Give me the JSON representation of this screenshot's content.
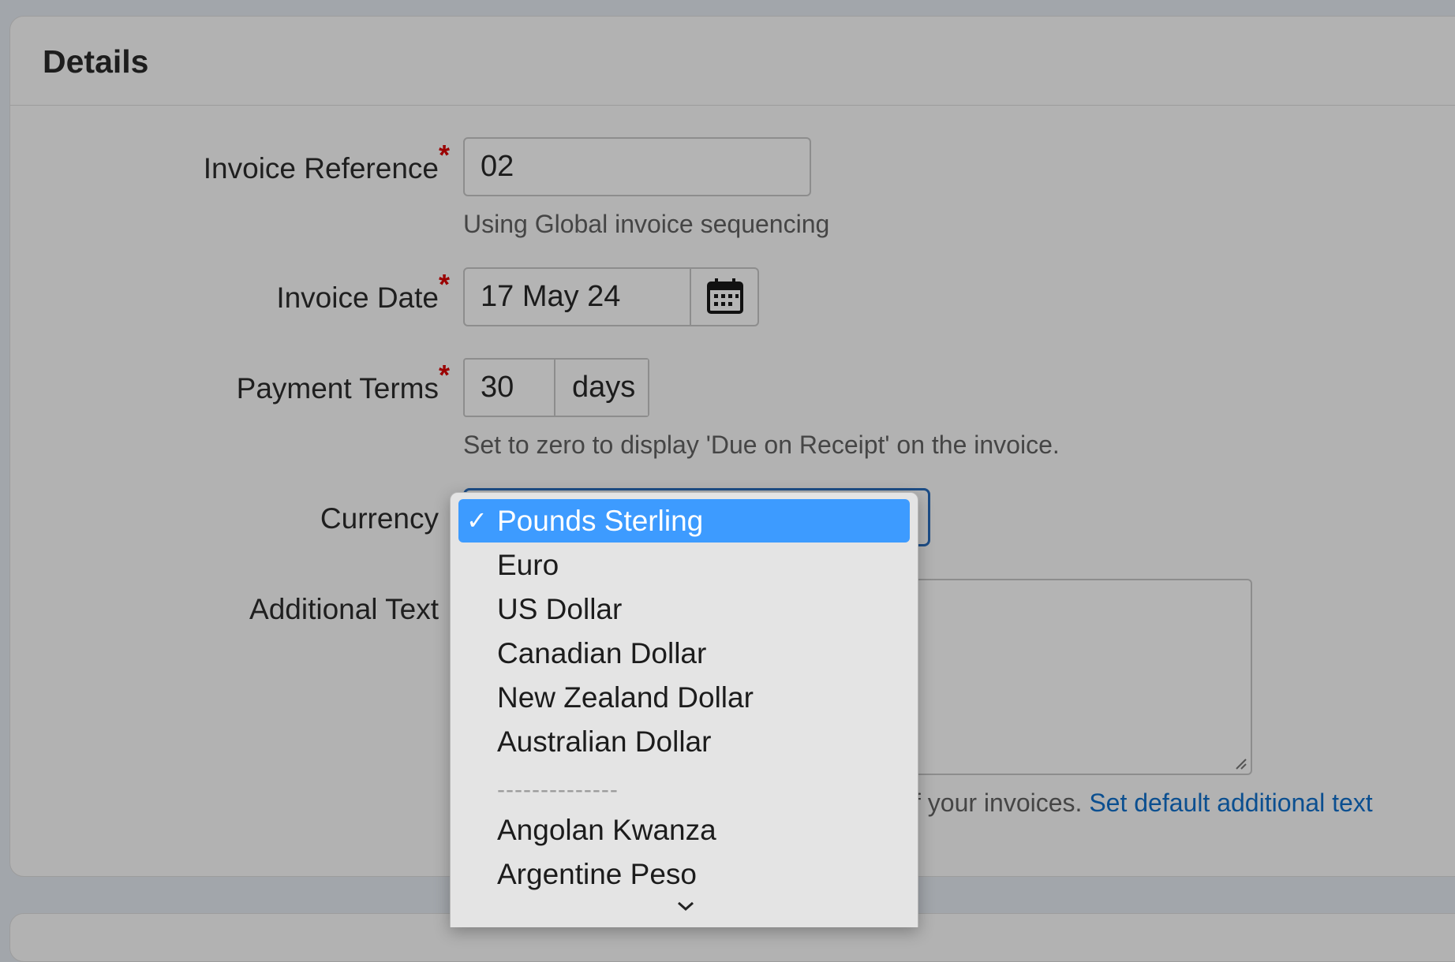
{
  "panel": {
    "title": "Details"
  },
  "invoice_reference": {
    "label": "Invoice Reference",
    "required_mark": "*",
    "value": "02",
    "help": "Using Global invoice sequencing"
  },
  "invoice_date": {
    "label": "Invoice Date",
    "required_mark": "*",
    "value": "17 May 24",
    "icon": "calendar-icon"
  },
  "payment_terms": {
    "label": "Payment Terms",
    "required_mark": "*",
    "value": "30",
    "unit": "days",
    "help": "Set to zero to display 'Due on Receipt' on the invoice."
  },
  "currency": {
    "label": "Currency",
    "selected": "Pounds Sterling",
    "check": "✓",
    "options": [
      "Pounds Sterling",
      "Euro",
      "US Dollar",
      "Canadian Dollar",
      "New Zealand Dollar",
      "Australian Dollar",
      "Angolan Kwanza",
      "Argentine Peso"
    ],
    "separator": "--------------",
    "scroll_icon": "chevron-down-icon"
  },
  "additional_text": {
    "label": "Additional Text",
    "help_visible": "f your invoices.",
    "link": "Set default additional text"
  },
  "colors": {
    "selected_option": "#3d9bff",
    "link": "#0b4f90",
    "required": "#9b0000",
    "focus_border": "#1d4d86"
  }
}
